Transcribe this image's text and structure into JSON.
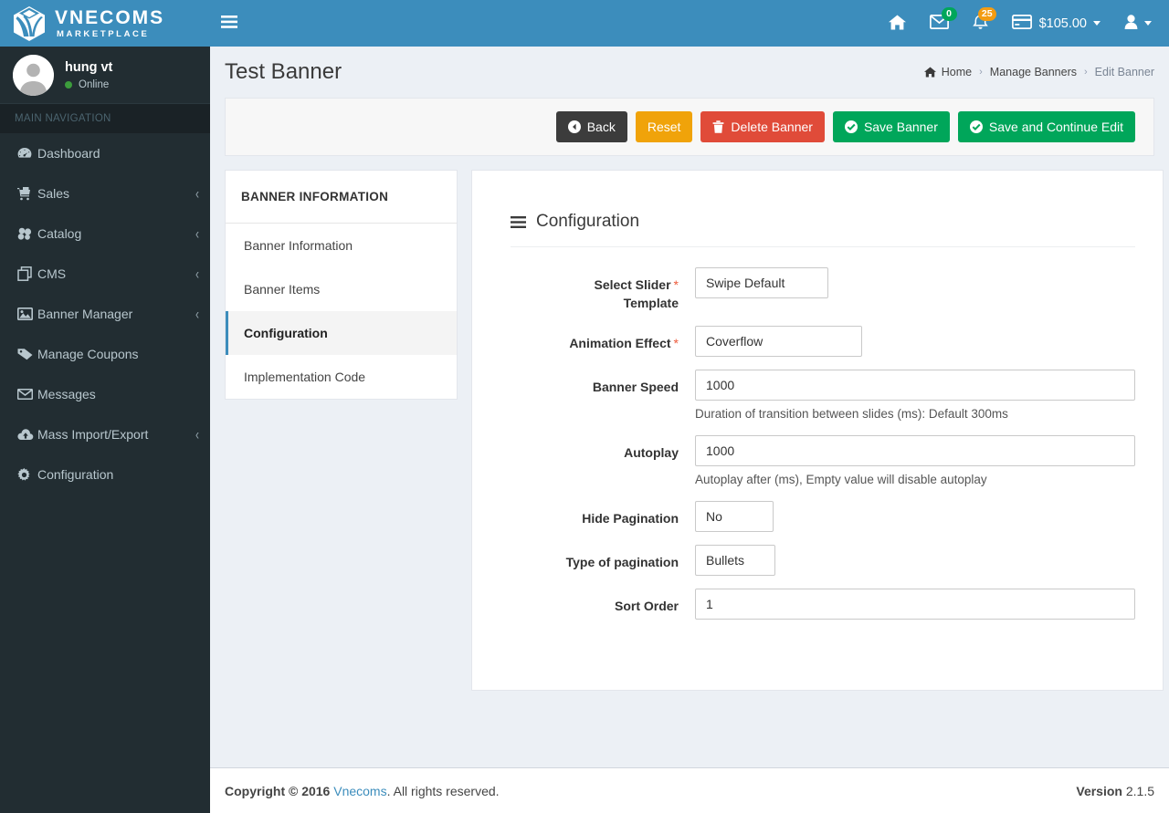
{
  "brand": {
    "title": "VNECOMS",
    "subtitle": "MARKETPLACE",
    "logo_icon": "vnecoms-leaf-logo",
    "header_color": "#3c8dbc",
    "sidebar_color": "#222d32"
  },
  "user_panel": {
    "name": "hung vt",
    "status": "Online",
    "status_color": "#3c9c3c",
    "avatar_icon": "user-avatar"
  },
  "sidebar": {
    "header": "MAIN NAVIGATION",
    "items": [
      {
        "label": "Dashboard",
        "icon": "dashboard-icon",
        "arrow": ""
      },
      {
        "label": "Sales",
        "icon": "cart-icon",
        "arrow": "‹"
      },
      {
        "label": "Catalog",
        "icon": "catalog-icon",
        "arrow": "‹"
      },
      {
        "label": "CMS",
        "icon": "copy-icon",
        "arrow": "‹"
      },
      {
        "label": "Banner Manager",
        "icon": "image-icon",
        "arrow": "‹"
      },
      {
        "label": "Manage Coupons",
        "icon": "tag-icon",
        "arrow": ""
      },
      {
        "label": "Messages",
        "icon": "envelope-icon",
        "arrow": ""
      },
      {
        "label": "Mass Import/Export",
        "icon": "cloud-upload-icon",
        "arrow": "‹"
      },
      {
        "label": "Configuration",
        "icon": "gear-icon",
        "arrow": ""
      }
    ]
  },
  "topbar": {
    "toggle_icon": "hamburger-icon",
    "home_icon": "home-icon",
    "messages": {
      "icon": "envelope-icon",
      "badge": "0",
      "badge_color": "#00a65a"
    },
    "notifications": {
      "icon": "bell-icon",
      "badge": "25",
      "badge_color": "#f39c12"
    },
    "wallet": {
      "icon": "credit-card-icon",
      "amount": "$105.00"
    },
    "account_icon": "user-icon"
  },
  "page": {
    "title": "Test Banner",
    "breadcrumb": {
      "home_icon": "home-icon",
      "items": [
        "Home",
        "Manage Banners",
        "Edit Banner"
      ],
      "separator": "›"
    }
  },
  "toolbar": {
    "back_label": "Back",
    "back_icon": "arrow-circle-left-icon",
    "reset_label": "Reset",
    "delete_label": "Delete Banner",
    "delete_icon": "trash-icon",
    "save_label": "Save Banner",
    "save_icon": "check-circle-icon",
    "save_continue_label": "Save and Continue Edit",
    "save_continue_icon": "check-circle-icon"
  },
  "side_card": {
    "header": "BANNER INFORMATION",
    "links": [
      {
        "label": "Banner Information",
        "active": false
      },
      {
        "label": "Banner Items",
        "active": false
      },
      {
        "label": "Configuration",
        "active": true
      },
      {
        "label": "Implementation Code",
        "active": false
      }
    ]
  },
  "form": {
    "title": "Configuration",
    "title_icon": "hamburger-icon",
    "required_mark": "*",
    "fields": {
      "slider_template": {
        "label_line1": "Select Slider",
        "label_line2": "Template",
        "value": "Swipe Default"
      },
      "animation_effect": {
        "label": "Animation Effect",
        "value": "Coverflow"
      },
      "banner_speed": {
        "label": "Banner Speed",
        "value": "1000",
        "help": "Duration of transition between slides (ms): Default 300ms"
      },
      "autoplay": {
        "label": "Autoplay",
        "value": "1000",
        "help": "Autoplay after (ms), Empty value will disable autoplay"
      },
      "hide_pagination": {
        "label": "Hide Pagination",
        "value": "No"
      },
      "type_of_pagination": {
        "label": "Type of pagination",
        "value": "Bullets"
      },
      "sort_order": {
        "label": "Sort Order",
        "value": "1"
      }
    }
  },
  "footer": {
    "copyright_strong": "Copyright © 2016",
    "company_link": "Vnecoms",
    "copyright_rest": ". All rights reserved.",
    "version_label": "Version",
    "version_value": "2.1.5"
  }
}
